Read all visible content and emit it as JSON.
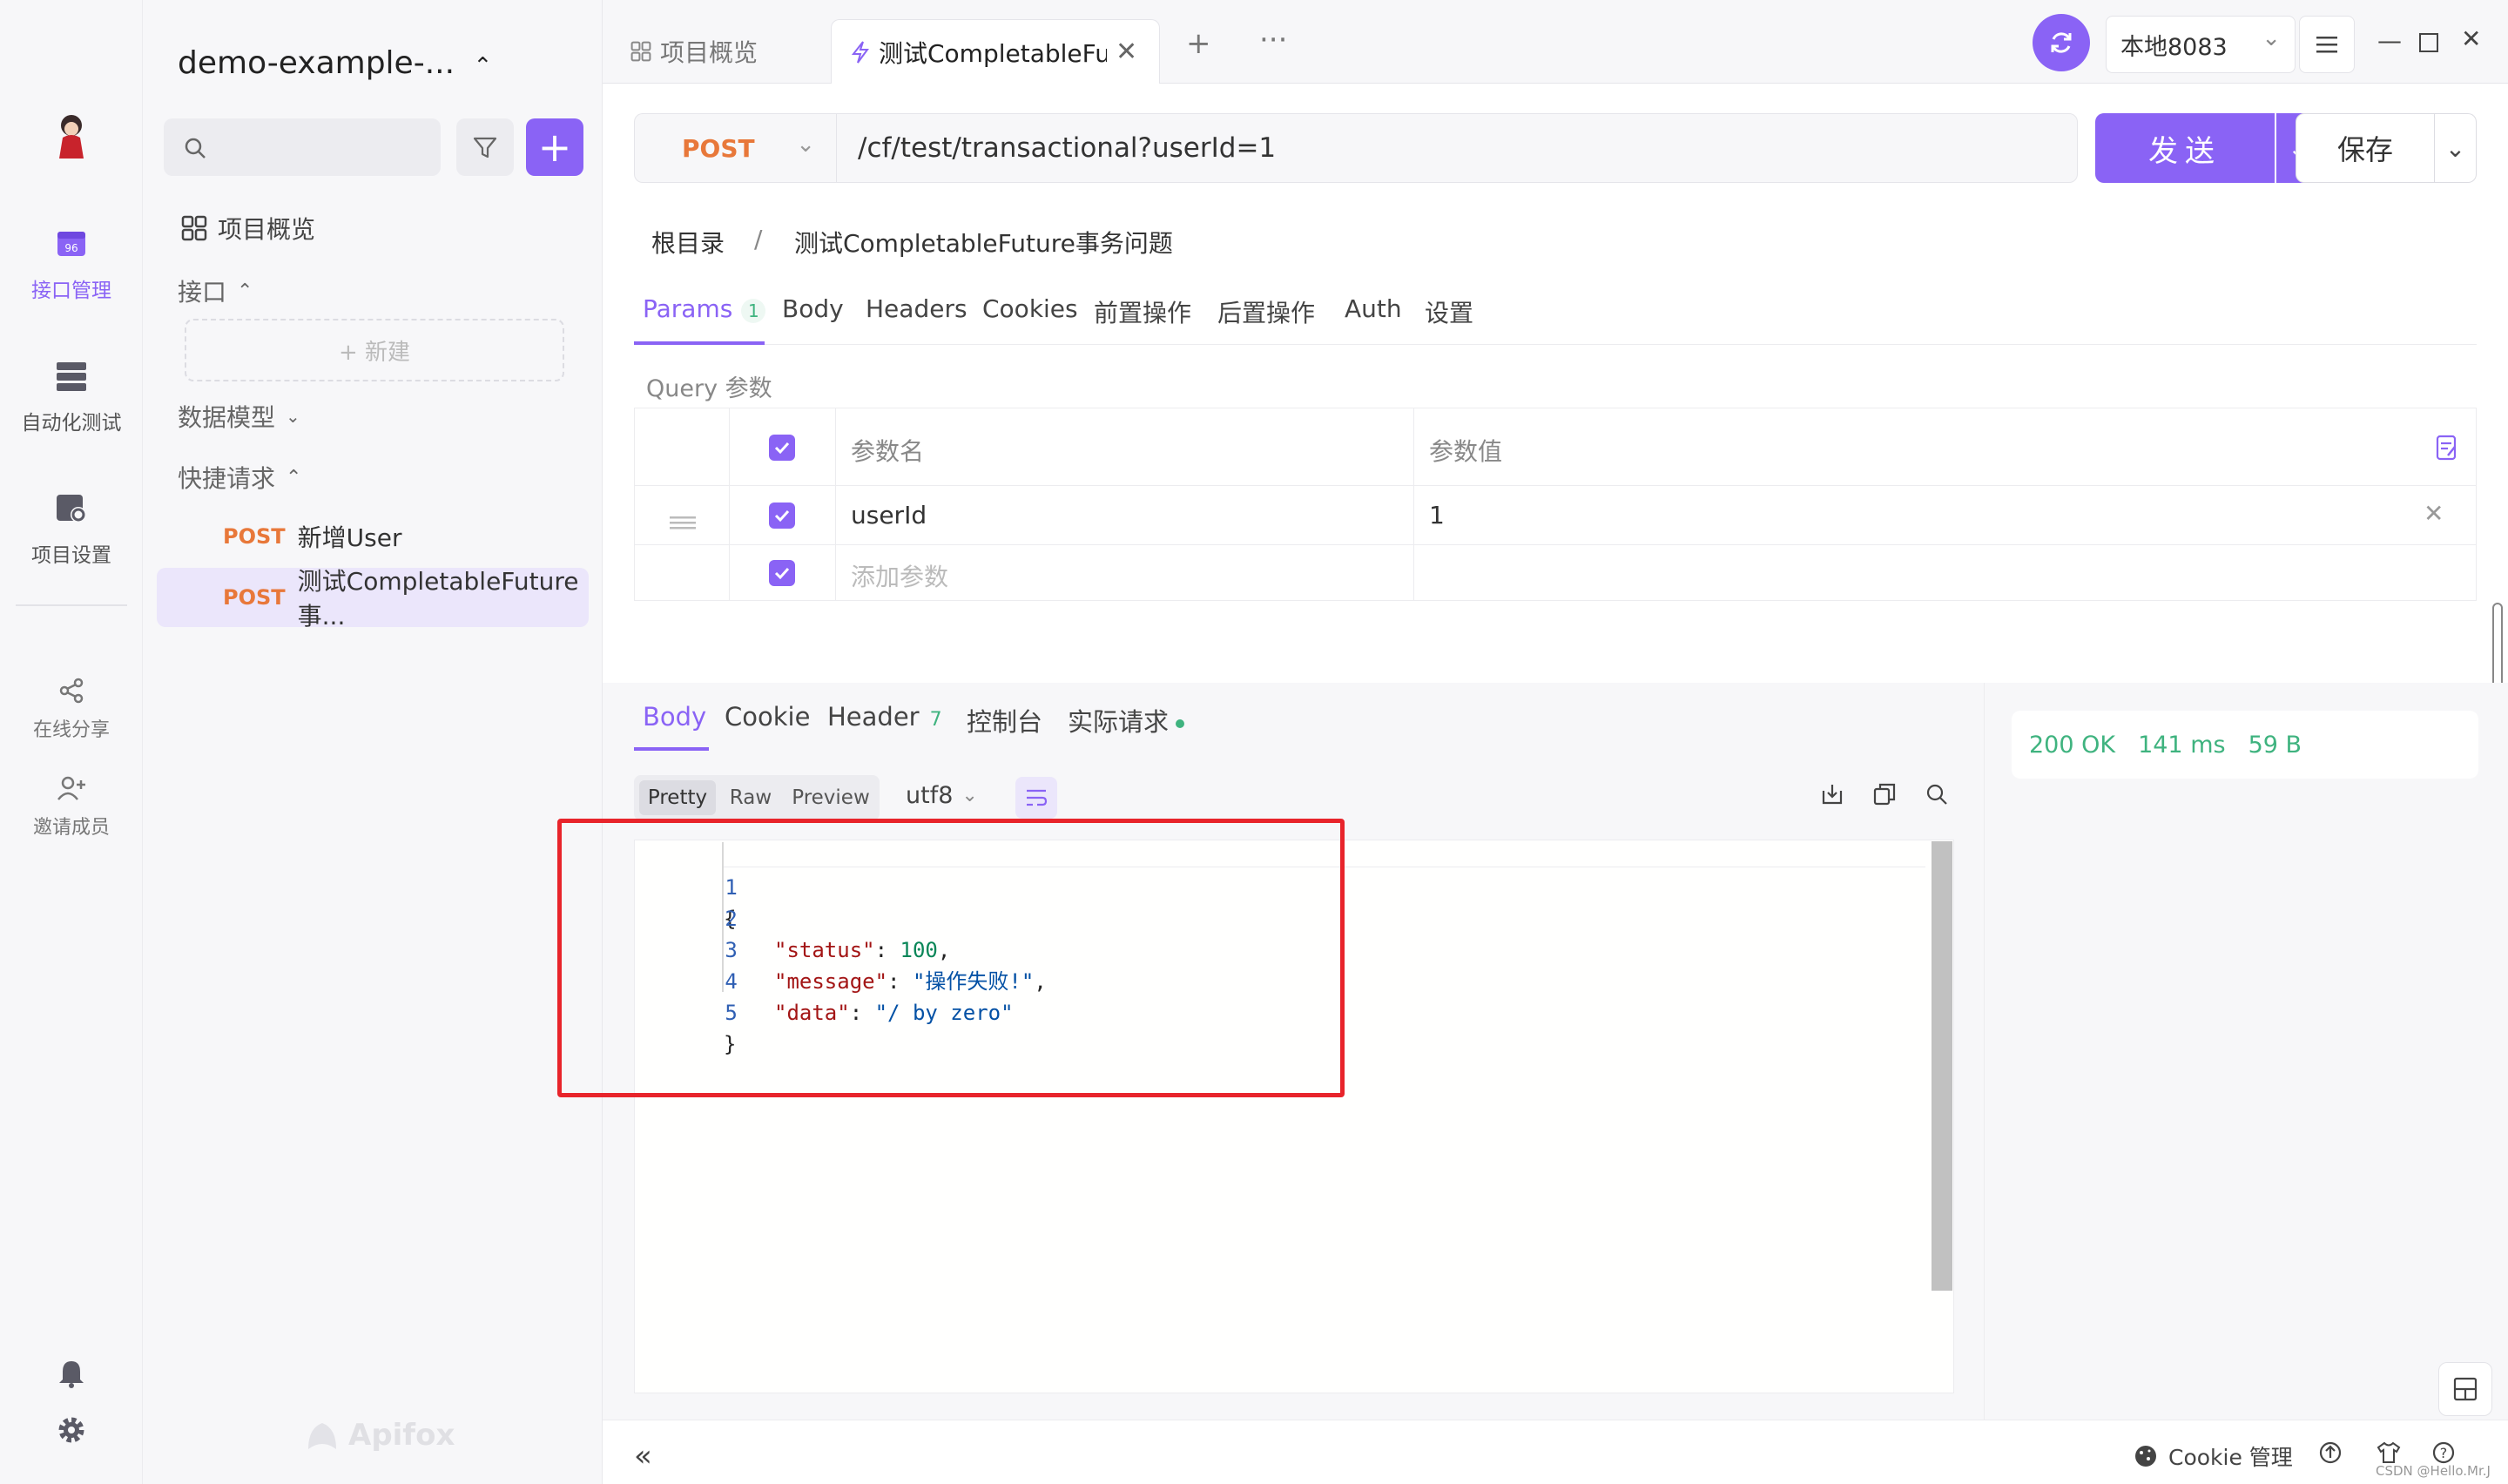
{
  "rail": {
    "items": [
      {
        "label": "接口管理",
        "icon": "api-management-icon"
      },
      {
        "label": "自动化测试",
        "icon": "automation-test-icon"
      },
      {
        "label": "项目设置",
        "icon": "project-settings-icon"
      },
      {
        "label": "在线分享",
        "icon": "share-icon"
      },
      {
        "label": "邀请成员",
        "icon": "invite-member-icon"
      }
    ]
  },
  "sidebar": {
    "project_name": "demo-example-...",
    "overview": "项目概览",
    "interfaces": "接口",
    "new_label": "+ 新建",
    "data_models": "数据模型",
    "quick_requests": "快捷请求",
    "requests": [
      {
        "method": "POST",
        "name": "新增User"
      },
      {
        "method": "POST",
        "name": "测试CompletableFuture事..."
      }
    ],
    "watermark": "Apifox"
  },
  "tabbar": {
    "tabs": [
      {
        "label": "项目概览"
      },
      {
        "label": "测试CompletableFutu"
      }
    ],
    "environment": "本地8083"
  },
  "request": {
    "method": "POST",
    "url": "/cf/test/transactional?userId=1",
    "send_label": "发送",
    "save_label": "保存"
  },
  "breadcrumb": {
    "root": "根目录",
    "separator": "/",
    "current": "测试CompletableFuture事务问题"
  },
  "param_tabs": [
    {
      "label": "Params",
      "badge": "1"
    },
    {
      "label": "Body"
    },
    {
      "label": "Headers"
    },
    {
      "label": "Cookies"
    },
    {
      "label": "前置操作"
    },
    {
      "label": "后置操作"
    },
    {
      "label": "Auth"
    },
    {
      "label": "设置"
    }
  ],
  "query": {
    "label": "Query 参数",
    "headers": {
      "name": "参数名",
      "value": "参数值"
    },
    "rows": [
      {
        "name": "userId",
        "value": "1"
      }
    ],
    "add_placeholder": "添加参数"
  },
  "response": {
    "tabs": [
      {
        "label": "Body"
      },
      {
        "label": "Cookie"
      },
      {
        "label": "Header",
        "badge": "7"
      },
      {
        "label": "控制台"
      },
      {
        "label": "实际请求"
      }
    ],
    "formats": [
      "Pretty",
      "Raw",
      "Preview"
    ],
    "encoding": "utf8",
    "status": {
      "code": "200 OK",
      "time": "141 ms",
      "size": "59 B"
    },
    "lines": [
      {
        "no": "1",
        "text": "{"
      },
      {
        "no": "2",
        "key": "\"status\"",
        "value": "100",
        "type": "number",
        "trail": ","
      },
      {
        "no": "3",
        "key": "\"message\"",
        "value": "\"操作失败!\"",
        "type": "string",
        "trail": ","
      },
      {
        "no": "4",
        "key": "\"data\"",
        "value": "\"/ by zero\"",
        "type": "string",
        "trail": ""
      },
      {
        "no": "5",
        "text": "}"
      }
    ]
  },
  "footer": {
    "cookie_manager": "Cookie 管理",
    "credit": "CSDN @Hello.Mr.J"
  },
  "colors": {
    "accent": "#8a63f5",
    "post": "#e8783a",
    "success": "#3fb37f",
    "highlight_box": "#e8242b"
  }
}
